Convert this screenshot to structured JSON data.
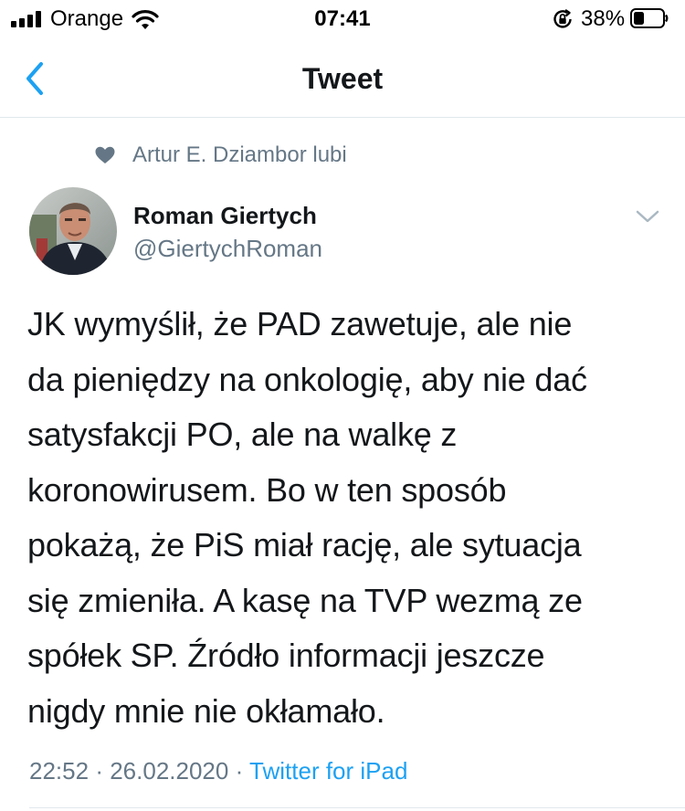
{
  "status_bar": {
    "carrier": "Orange",
    "time": "07:41",
    "battery_percent": "38%",
    "battery_level": 0.38
  },
  "nav": {
    "title": "Tweet",
    "back_icon": "chevron-left-icon"
  },
  "social_context": {
    "icon": "heart-icon",
    "text": "Artur E. Dziambor lubi"
  },
  "author": {
    "name": "Roman Giertych",
    "handle": "@GiertychRoman"
  },
  "tweet": {
    "lines": [
      "JK wymyślił, że PAD zawetuje, ale nie",
      "da pieniędzy na onkologię, aby nie dać",
      "satysfakcji PO, ale na walkę z",
      "koronowirusem. Bo w ten sposób",
      "pokażą, że PiS miał rację, ale sytuacja",
      "się zmieniła. A kasę na TVP wezmą ze",
      "spółek SP. Źródło informacji jeszcze",
      "nigdy mnie nie okłamało."
    ],
    "time": "22:52",
    "separator": "·",
    "date": "26.02.2020",
    "source": "Twitter for iPad"
  },
  "colors": {
    "accent": "#1da1f2",
    "secondary_text": "#657786",
    "primary_text": "#14171a",
    "divider": "#e1e8ed"
  }
}
